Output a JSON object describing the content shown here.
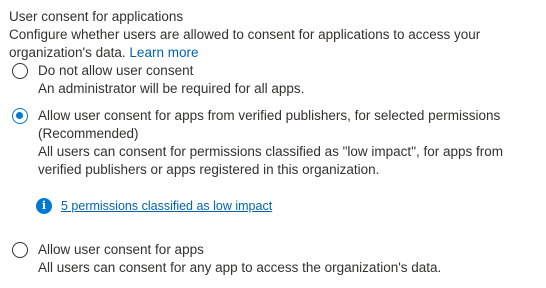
{
  "section": {
    "title": "User consent for applications",
    "description": "Configure whether users are allowed to consent for applications to access your organization's data.",
    "learn_more": "Learn more"
  },
  "options": [
    {
      "label": "Do not allow user consent",
      "description": "An administrator will be required for all apps.",
      "selected": false
    },
    {
      "label": "Allow user consent for apps from verified publishers, for selected permissions (Recommended)",
      "description": "All users can consent for permissions classified as \"low impact\", for apps from verified publishers or apps registered in this organization.",
      "selected": true
    },
    {
      "label": "Allow user consent for apps",
      "description": "All users can consent for any app to access the organization's data.",
      "selected": false
    }
  ],
  "info": {
    "icon": "info-icon",
    "link_text": "5 permissions classified as low impact"
  },
  "colors": {
    "accent": "#0078d4",
    "link": "#0063b1",
    "text": "#323130"
  }
}
